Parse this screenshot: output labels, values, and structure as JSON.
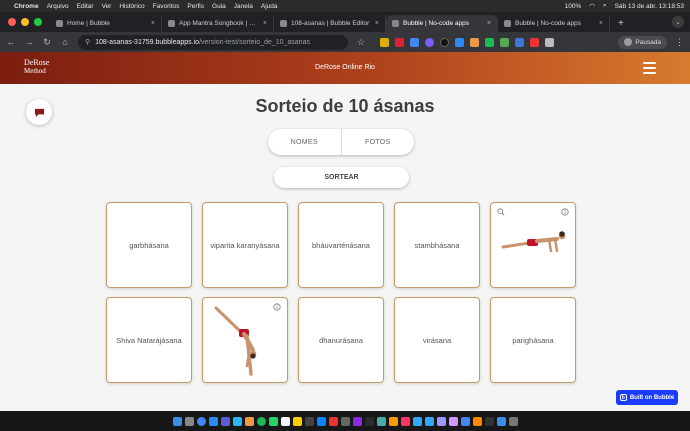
{
  "menubar": {
    "app": "Chrome",
    "items": [
      "Arquivo",
      "Editar",
      "Ver",
      "Histórico",
      "Favoritos",
      "Perfis",
      "Guia",
      "Janela",
      "Ajuda"
    ],
    "battery": "100%",
    "datetime": "Sáb 13 de abr.  13:18:53"
  },
  "tabs": [
    {
      "title": "Home | Bubble",
      "color": "#4a6cf7"
    },
    {
      "title": "App Mantra Songbook | Bubble",
      "color": "#4a6cf7"
    },
    {
      "title": "108-asanas | Bubble Editor",
      "color": "#4a6cf7"
    },
    {
      "title": "Bubble | No-code apps",
      "color": "#4a6cf7"
    },
    {
      "title": "Bubble | No-code apps",
      "color": "#4a6cf7"
    }
  ],
  "toolbar": {
    "url_host": "108-asanas-31759.bubbleapps.io",
    "url_path": "/version-test/sorteio_de_10_asanas",
    "profile": "Pausada"
  },
  "header": {
    "logo_line1": "DeRose",
    "logo_line2": "Method",
    "title": "DeRose Online Rio"
  },
  "page": {
    "title": "Sorteio de 10 ásanas",
    "segment_names": "NOMES",
    "segment_photos": "FOTOS",
    "draw_button": "SORTEAR"
  },
  "cards": [
    {
      "label": "garbhásana",
      "photo": false
    },
    {
      "label": "viparita karanyásana",
      "photo": false
    },
    {
      "label": "bháuvarténásana",
      "photo": false
    },
    {
      "label": "stambhásana",
      "photo": false
    },
    {
      "label": "",
      "photo": true,
      "pose": "plank-pose"
    },
    {
      "label": "Shiva Natarájásana",
      "photo": false
    },
    {
      "label": "",
      "photo": true,
      "pose": "standing-split-pose"
    },
    {
      "label": "dhanurásana",
      "photo": false
    },
    {
      "label": "virásana",
      "photo": false
    },
    {
      "label": "parighásana",
      "photo": false
    }
  ],
  "badge": {
    "label": "Built on Bubble"
  },
  "colors": {
    "header_start": "#7c1d10",
    "header_end": "#d87a2e",
    "card_border": "#c99a6a",
    "accent_red": "#8b1a1a",
    "badge_blue": "#1a3cff"
  }
}
